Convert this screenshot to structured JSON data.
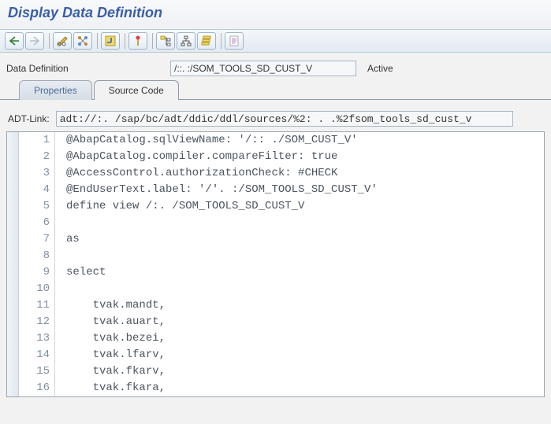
{
  "title": "Display Data Definition",
  "header": {
    "label": "Data Definition",
    "field_value": "/::. :/SOM_TOOLS_SD_CUST_V",
    "status": "Active"
  },
  "tabs": {
    "properties": "Properties",
    "source_code": "Source Code"
  },
  "adt": {
    "label": "ADT-Link:",
    "value": "adt://:. /sap/bc/adt/ddic/ddl/sources/%2:  . .%2fsom_tools_sd_cust_v"
  },
  "code": {
    "lines": [
      {
        "n": "1",
        "text": "@AbapCatalog.sqlViewName: '/:: ./SOM_CUST_V'"
      },
      {
        "n": "2",
        "text": "@AbapCatalog.compiler.compareFilter: true"
      },
      {
        "n": "3",
        "text": "@AccessControl.authorizationCheck: #CHECK"
      },
      {
        "n": "4",
        "text": "@EndUserText.label: '/'. :/SOM_TOOLS_SD_CUST_V'"
      },
      {
        "n": "5",
        "text": "define view /:. /SOM_TOOLS_SD_CUST_V"
      },
      {
        "n": "6",
        "text": ""
      },
      {
        "n": "7",
        "text": "as"
      },
      {
        "n": "8",
        "text": ""
      },
      {
        "n": "9",
        "text": "select"
      },
      {
        "n": "10",
        "text": ""
      },
      {
        "n": "11",
        "text": "    tvak.mandt,"
      },
      {
        "n": "12",
        "text": "    tvak.auart,"
      },
      {
        "n": "13",
        "text": "    tvak.bezei,"
      },
      {
        "n": "14",
        "text": "    tvak.lfarv,"
      },
      {
        "n": "15",
        "text": "    tvak.fkarv,"
      },
      {
        "n": "16",
        "text": "    tvak.fkara,"
      }
    ]
  }
}
